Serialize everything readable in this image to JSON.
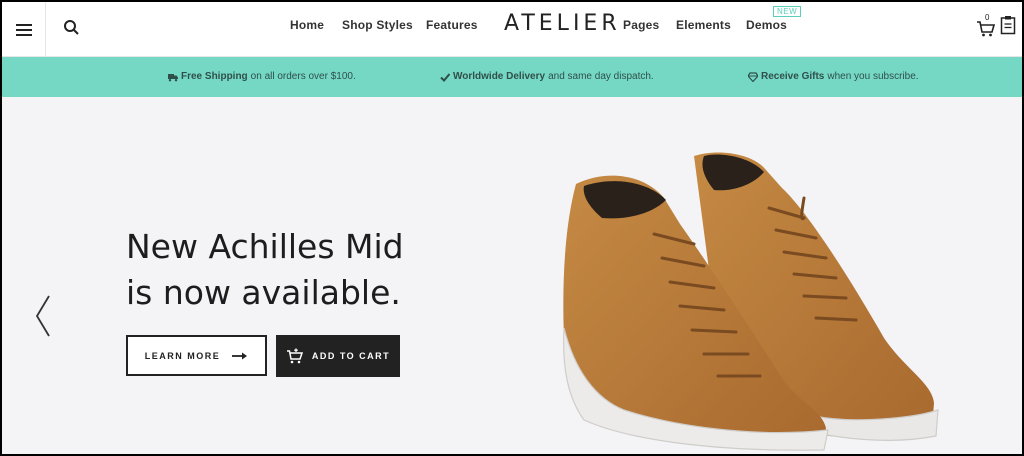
{
  "header": {
    "menu_icon": "hamburger-menu-icon",
    "search_icon": "search-icon",
    "nav_left": [
      "Home",
      "Shop Styles",
      "Features"
    ],
    "logo": "ATELIER",
    "nav_right": [
      "Pages",
      "Elements",
      "Demos"
    ],
    "new_badge": "NEW",
    "cart_count": "0",
    "cart_icon": "cart-icon",
    "wishlist_icon": "wishlist-icon"
  },
  "infobar": {
    "background": "#75d8c5",
    "items": [
      {
        "icon": "truck-icon",
        "bold": "Free Shipping",
        "text": "on all orders over $100."
      },
      {
        "icon": "check-icon",
        "bold": "Worldwide Delivery",
        "text": "and same day dispatch."
      },
      {
        "icon": "diamond-icon",
        "bold": "Receive Gifts",
        "text": "when you subscribe."
      }
    ]
  },
  "hero": {
    "title_line1": "New Achilles Mid",
    "title_line2": "is now available.",
    "learn_more": "LEARN MORE",
    "add_to_cart": "ADD TO CART",
    "prev_icon": "chevron-left-icon",
    "image": "suede-high-top-sneakers"
  }
}
